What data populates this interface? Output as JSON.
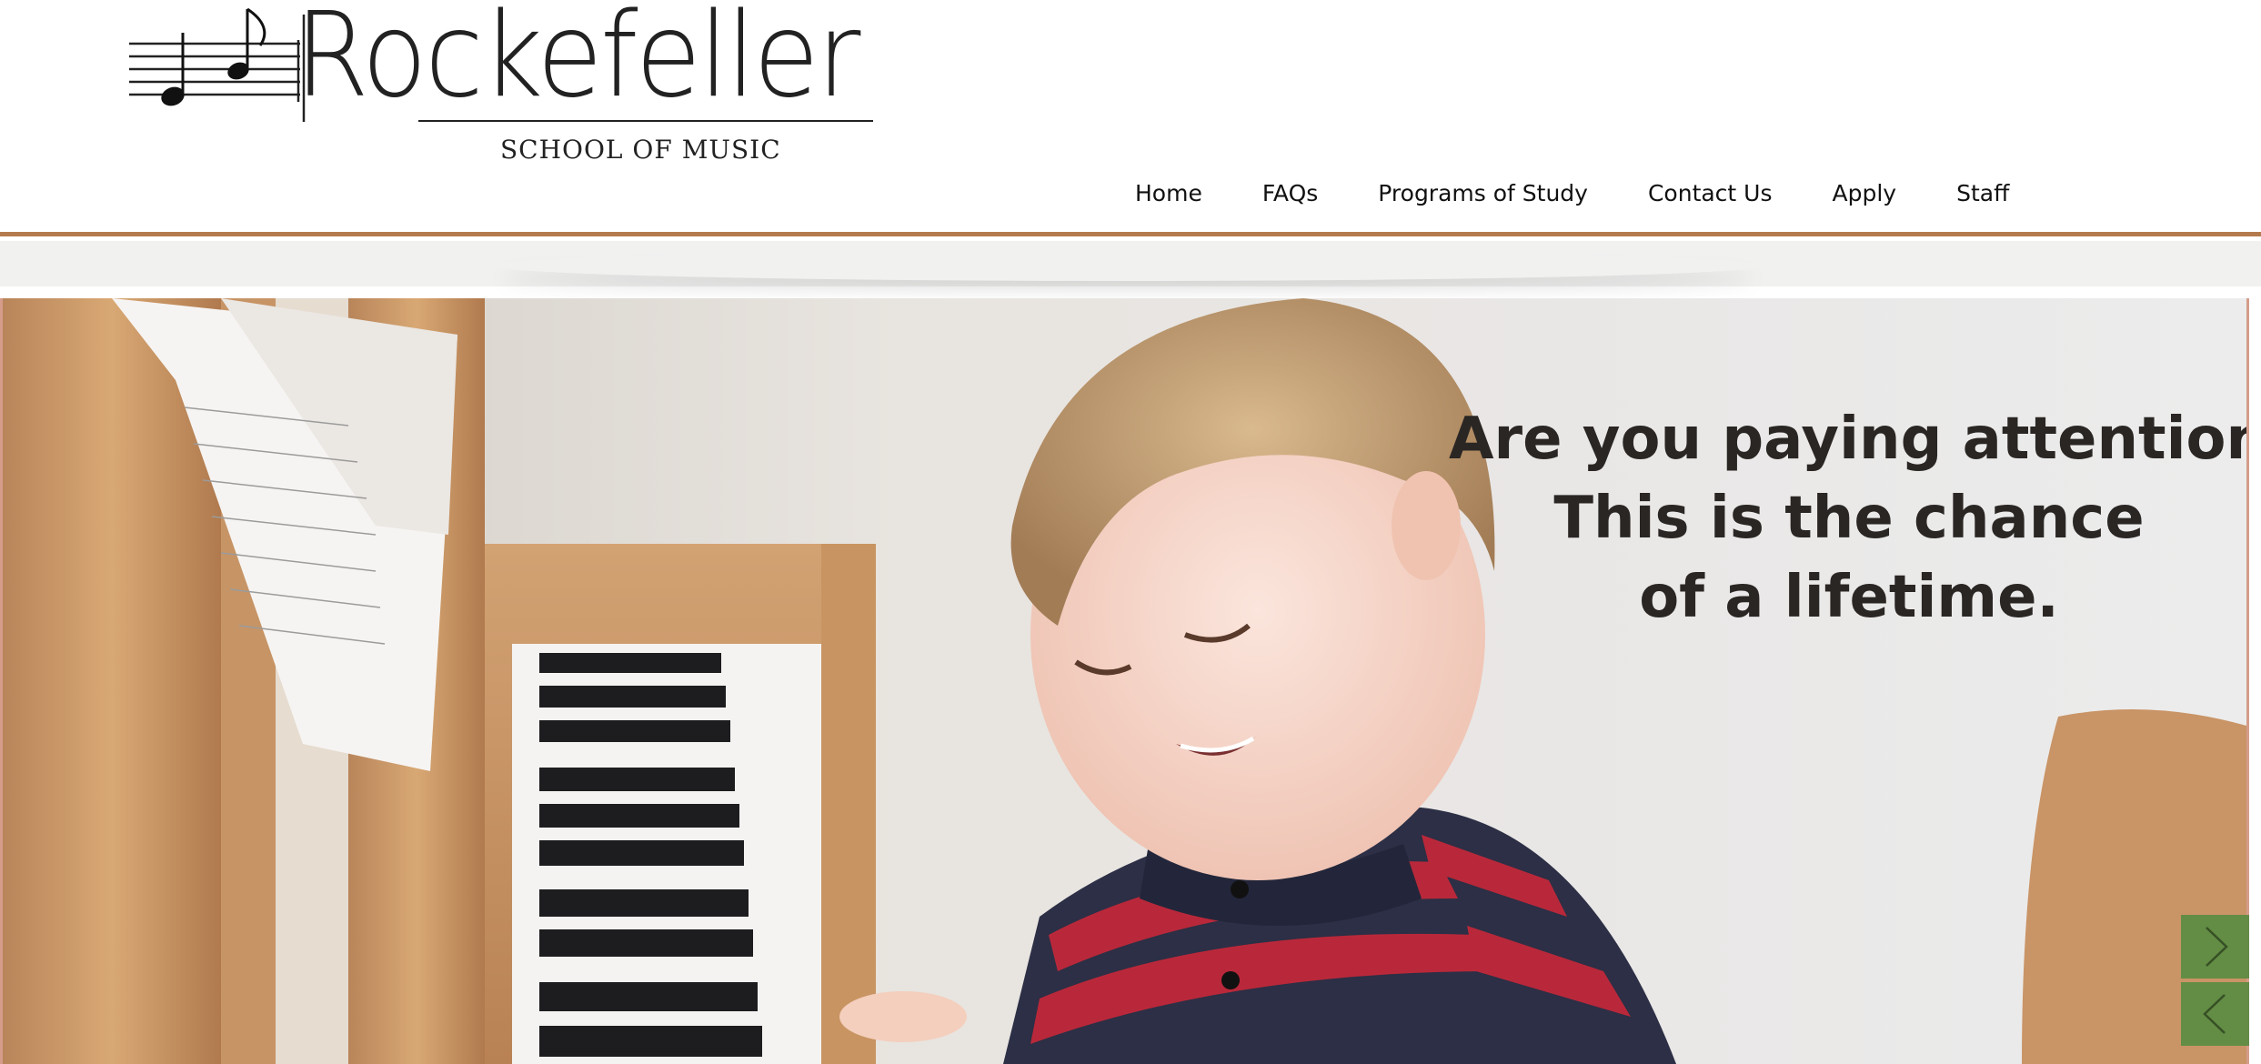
{
  "logo": {
    "wordmark": "Rockefeller",
    "subtitle": "SCHOOL OF MUSIC"
  },
  "nav": {
    "items": [
      {
        "label": "Home"
      },
      {
        "label": "FAQs"
      },
      {
        "label": "Programs of Study"
      },
      {
        "label": "Contact Us"
      },
      {
        "label": "Apply"
      },
      {
        "label": "Staff"
      }
    ]
  },
  "hero": {
    "headline_lines": [
      "Are you paying attention?",
      "This is the chance",
      "of a lifetime."
    ],
    "next_icon": "chevron-right-icon",
    "prev_icon": "chevron-left-icon"
  },
  "colors": {
    "accent_border": "#b37a4c",
    "slider_button": "#5e8c43",
    "headline_text": "#2a2624"
  }
}
